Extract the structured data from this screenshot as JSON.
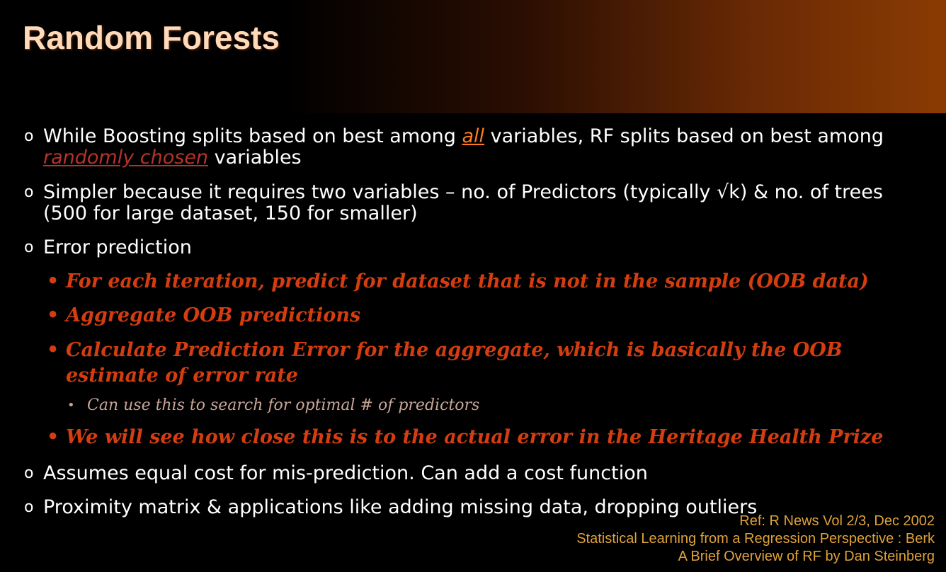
{
  "slide": {
    "title": "Random Forests",
    "bullets": [
      {
        "marker": "o",
        "pre": "While Boosting splits based on best among ",
        "em1": "all",
        "mid": " variables, RF splits based on best among ",
        "em2": "randomly chosen",
        "post": " variables"
      },
      {
        "marker": "o",
        "text": " Simpler because it requires two variables – no. of Predictors (typically √k) & no. of trees (500 for large dataset, 150 for smaller)"
      },
      {
        "marker": "o",
        "text": "Error prediction",
        "sub": [
          {
            "bullet": "•",
            "text": "For each iteration, predict for dataset that is not in the sample (OOB data)"
          },
          {
            "bullet": "•",
            "text": "Aggregate OOB predictions"
          },
          {
            "bullet": "•",
            "text": "Calculate Prediction Error for the aggregate, which is basically the OOB estimate of error rate",
            "sub": [
              {
                "bullet": "•",
                "text": "Can use this to search for optimal # of predictors"
              }
            ]
          },
          {
            "bullet": "•",
            "text": "We will see how close this is to the actual error in the Heritage Health Prize"
          }
        ]
      },
      {
        "marker": "o",
        "text": "Assumes equal cost for mis-prediction. Can add a cost function"
      },
      {
        "marker": "o",
        "text": "Proximity matrix & applications like adding missing data, dropping outliers"
      }
    ],
    "references": [
      "Ref: R News Vol 2/3, Dec 2002",
      "Statistical Learning from a Regression Perspective : Berk",
      "A Brief Overview of RF by Dan Steinberg"
    ],
    "colors": {
      "background": "#000000",
      "title": "#ffd9b8",
      "body_text": "#ffffff",
      "sub_bullet": "#d33d10",
      "sub_sub_bullet": "#c9a597",
      "highlight_all": "#ff7a1e",
      "highlight_random": "#b5332a",
      "references": "#e0a23a",
      "header_gradient_end": "#8a3b03"
    }
  }
}
